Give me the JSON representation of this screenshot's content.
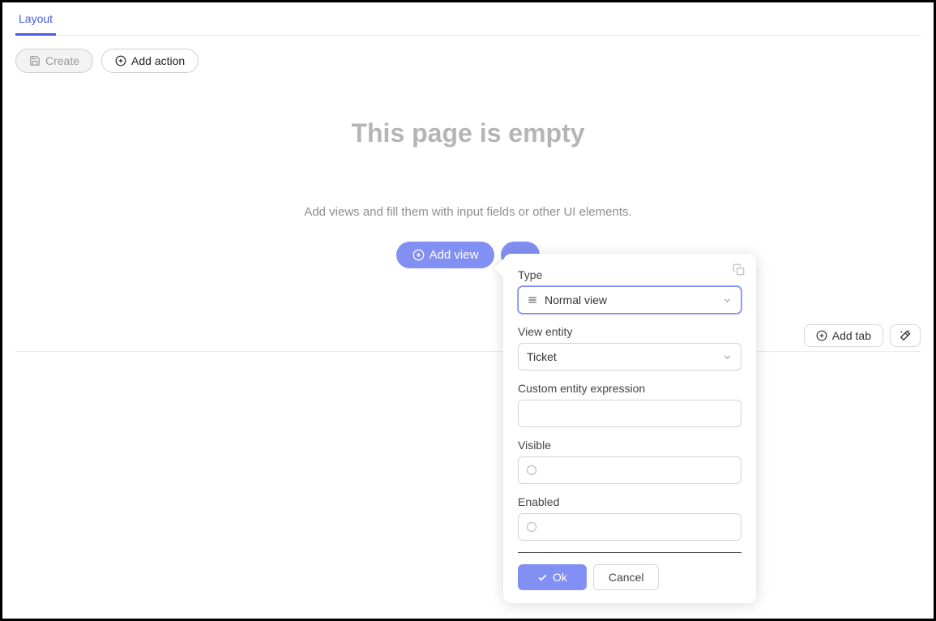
{
  "tabs": {
    "layout": "Layout"
  },
  "toolbar": {
    "create_label": "Create",
    "add_action_label": "Add action"
  },
  "empty": {
    "title": "This page is empty",
    "subtitle": "Add views and fill them with input fields or other UI elements.",
    "add_view_label": "Add view"
  },
  "bottom": {
    "add_tab_label": "Add tab"
  },
  "popover": {
    "type_label": "Type",
    "type_value": "Normal view",
    "view_entity_label": "View entity",
    "view_entity_value": "Ticket",
    "custom_expr_label": "Custom entity expression",
    "custom_expr_value": "",
    "visible_label": "Visible",
    "enabled_label": "Enabled",
    "ok_label": "Ok",
    "cancel_label": "Cancel"
  }
}
